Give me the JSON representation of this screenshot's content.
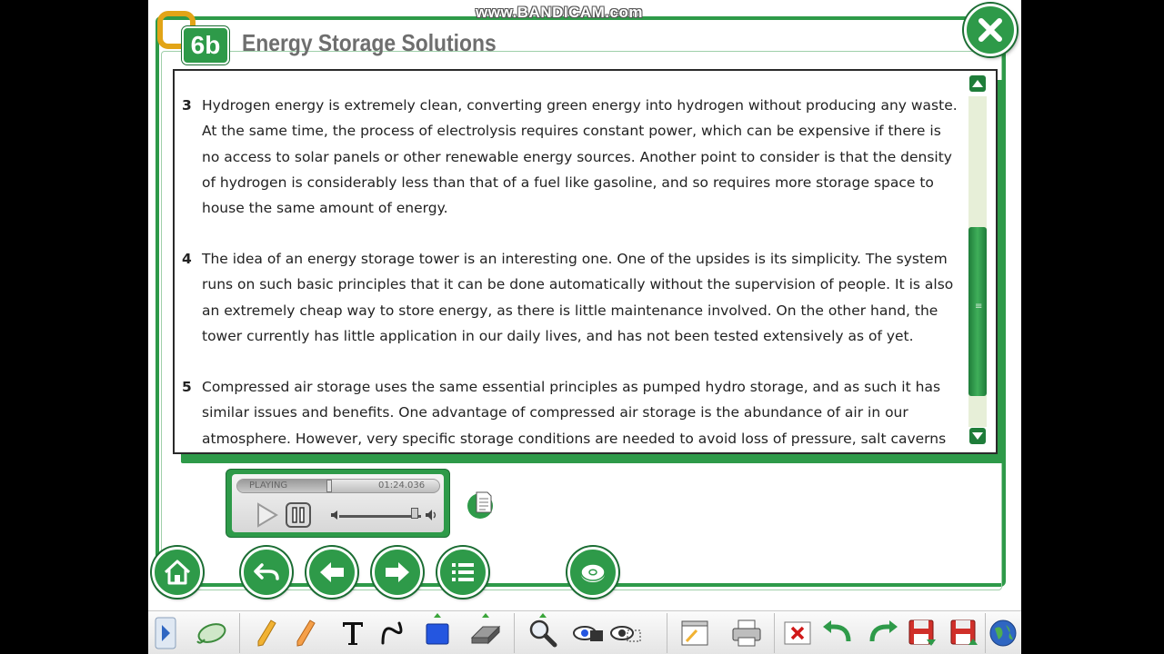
{
  "watermark": "www.BANDICAM.com",
  "header": {
    "badge": "6b",
    "title": "Energy Storage Solutions"
  },
  "content": {
    "paragraphs": [
      {
        "num": "3",
        "text": "Hydrogen energy is extremely clean, converting green energy into hydrogen without producing any waste. At the same time, the process of electrolysis requires constant power, which can be expensive if there is no access to solar panels or other renewable energy sources. Another point to consider is that the density of hydrogen is considerably less than that of a fuel like gasoline, and so requires more storage space to house the same amount of energy."
      },
      {
        "num": "4",
        "text": "The idea of an energy storage tower is an interesting one. One of the upsides is its simplicity. The system runs on such basic principles that it can be done automatically without the supervision of people. It is also an extremely cheap way to store energy, as there is little maintenance involved. On the other hand, the tower currently has little application in our daily lives, and has not been tested extensively as of yet."
      },
      {
        "num": "5",
        "text": "Compressed air storage uses the same essential principles as pumped hydro storage, and as such it has similar issues and benefits. One advantage of compressed air storage is the abundance of air in our atmosphere. However, very specific storage conditions are needed to avoid loss of pressure, salt caverns"
      }
    ]
  },
  "player": {
    "status": "PLAYING",
    "time": "01:24.036",
    "progress_fraction": 0.45,
    "volume_fraction": 0.92
  },
  "icons": {
    "close": "close-icon",
    "home": "home-icon",
    "undo": "undo-icon",
    "prev": "arrow-left-icon",
    "next": "arrow-right-icon",
    "menu": "list-icon",
    "cd": "disc-icon",
    "doc": "document-icon"
  },
  "colors": {
    "accent": "#2e9a49",
    "accent_dark": "#1b6d33",
    "logo_ring": "#e2a417"
  }
}
